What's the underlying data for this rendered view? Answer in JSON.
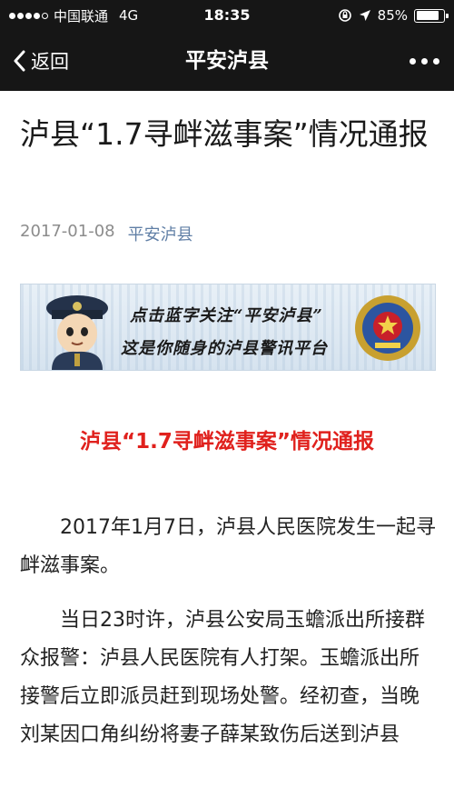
{
  "status_bar": {
    "carrier": "中国联通",
    "network": "4G",
    "time": "18:35",
    "battery_percent": "85%",
    "battery_level": 0.85
  },
  "nav": {
    "back_label": "返回",
    "title": "平安泸县"
  },
  "article": {
    "title": "泸县“1.7寻衅滋事案”情况通报",
    "date": "2017-01-08",
    "account": "平安泸县",
    "banner": {
      "line1": "点击蓝字关注“平安泸县”",
      "line2": "这是你随身的泸县警讯平台"
    },
    "heading": "泸县“1.7寻衅滋事案”情况通报",
    "paragraphs": [
      "2017年1月7日，泸县人民医院发生一起寻衅滋事案。",
      "当日23时许，泸县公安局玉蟾派出所接群众报警：泸县人民医院有人打架。玉蟾派出所接警后立即派员赶到现场处警。经初查，当晚刘某因口角纠纷将妻子薛某致伤后送到泸县"
    ]
  },
  "colors": {
    "bar_background": "#161616",
    "account_link": "#607fa6",
    "heading_red": "#e0211d"
  },
  "icons": [
    "signal-icon",
    "location-arrow-icon",
    "battery-icon",
    "back-chevron-icon",
    "more-dots-icon",
    "police-cartoon-icon",
    "police-emblem-icon"
  ]
}
